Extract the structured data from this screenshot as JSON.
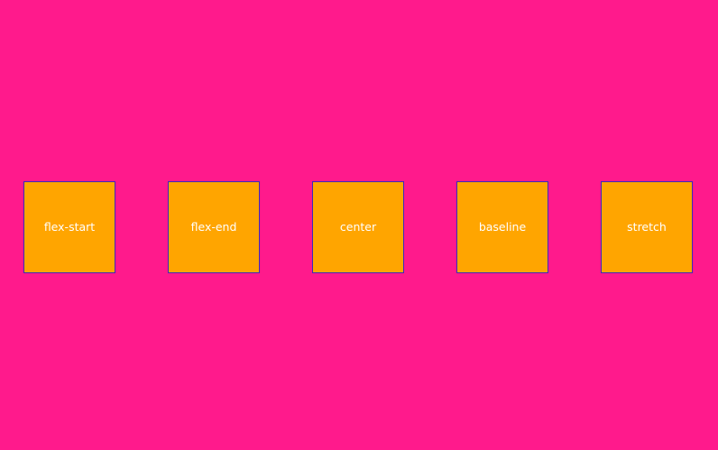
{
  "boxes": [
    {
      "label": "flex-start"
    },
    {
      "label": "flex-end"
    },
    {
      "label": "center"
    },
    {
      "label": "baseline"
    },
    {
      "label": "stretch"
    }
  ],
  "colors": {
    "background": "#ff1a8c",
    "box_fill": "#ffa500",
    "box_border": "#3b2bb8",
    "label_text": "#ffffff"
  }
}
